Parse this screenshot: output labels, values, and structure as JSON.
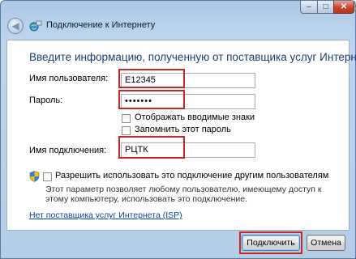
{
  "window": {
    "title": "Подключение к Интернету",
    "controls": {
      "minimize": "–",
      "maximize": "□",
      "close": "✕"
    }
  },
  "heading": "Введите информацию, полученную от поставщика услуг Интернета",
  "form": {
    "username": {
      "label": "Имя пользователя:",
      "value": "E12345"
    },
    "password": {
      "label": "Пароль:",
      "value": "•••••••"
    },
    "show_chars": {
      "label": "Отображать вводимые знаки",
      "checked": false
    },
    "remember_password": {
      "label": "Запомнить этот пароль",
      "checked": false
    },
    "connection_name": {
      "label": "Имя подключения:",
      "value": "РЦТК"
    },
    "allow_others": {
      "label": "Разрешить использовать это подключение другим пользователям",
      "checked": false,
      "note": "Этот параметр позволяет любому пользователю, имеющему доступ к этому компьютеру, использовать это подключение."
    }
  },
  "isp_link": "Нет поставщика услуг Интернета (ISP)",
  "buttons": {
    "connect": "Подключить",
    "cancel": "Отмена"
  },
  "colors": {
    "highlight": "#c62828",
    "heading": "#1e3c78",
    "link": "#0645ad"
  }
}
